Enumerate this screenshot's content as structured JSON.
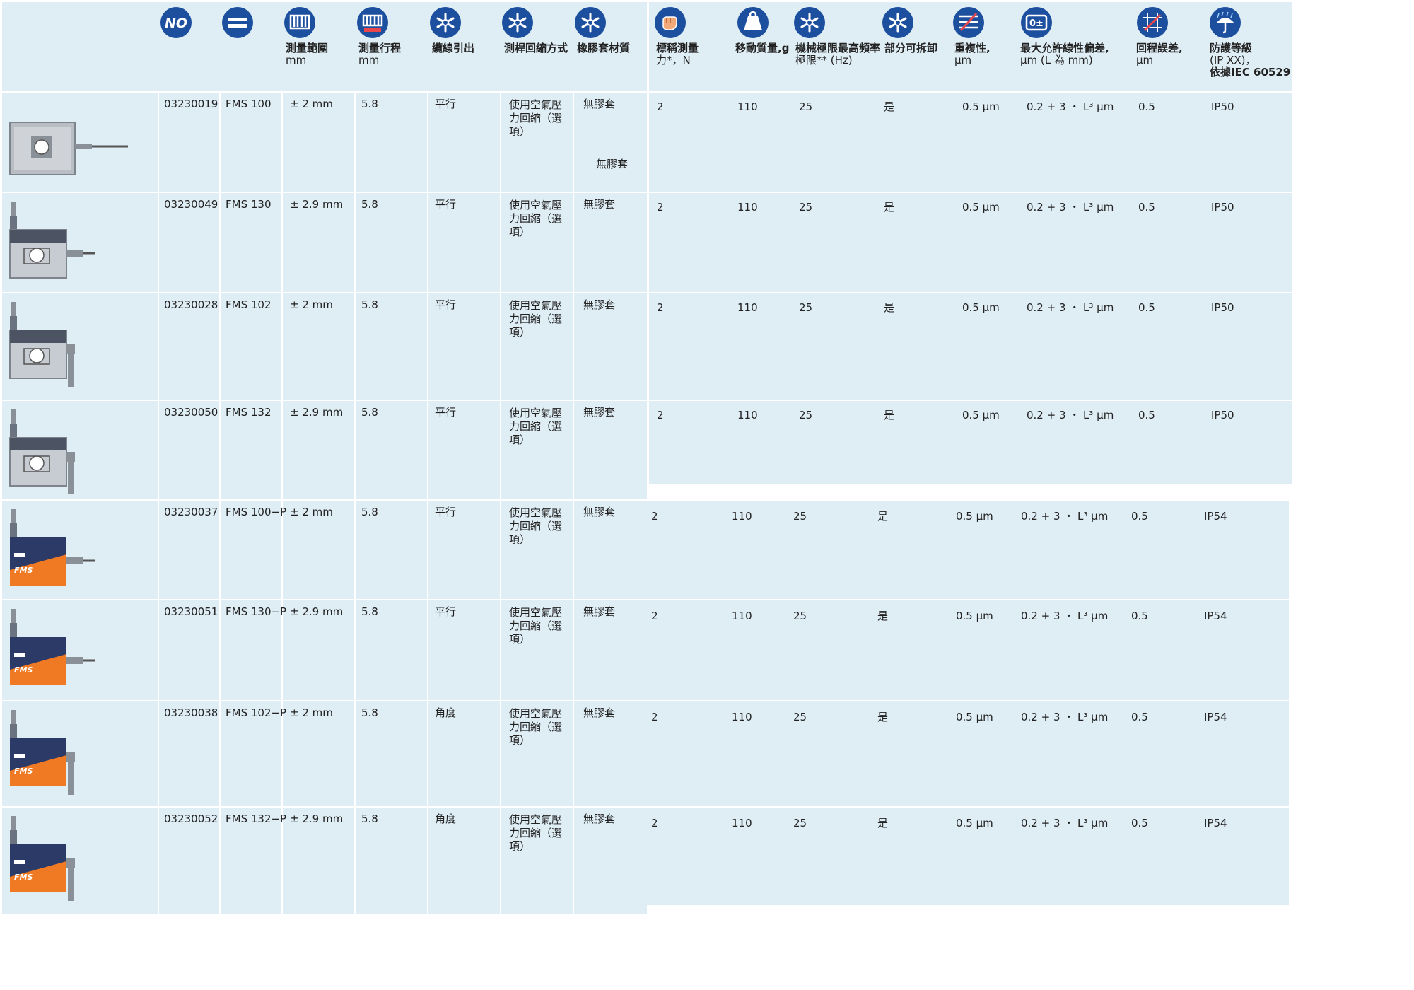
{
  "header": {
    "icons": {
      "col_no": "no-icon",
      "col_model": "double-bar-icon",
      "col_range": "measuring-range-icon",
      "col_stroke": "measuring-stroke-icon",
      "col_cable": "cable-exit-icon",
      "col_retract": "retraction-icon",
      "col_gaiter": "gaiter-material-icon",
      "col_force": "hand-force-icon",
      "col_mass": "moving-mass-icon",
      "col_freq": "frequency-icon",
      "col_detach": "detachable-icon",
      "col_repeat": "repeatability-icon",
      "col_linearity": "linearity-icon",
      "col_hysteresis": "hysteresis-icon",
      "col_ip": "protection-umbrella-icon"
    },
    "no_icon_text": "NO",
    "linearity_icon_text": "0±",
    "range_l1": "測量範圍",
    "range_l2": "mm",
    "stroke_l1": "測量行程",
    "stroke_l2": "mm",
    "cable": "纜線引出",
    "retract": "測桿回縮方式",
    "gaiter": "橡膠套材質",
    "force_l1": "標稱測量",
    "force_l2": "力*，N",
    "mass": "移動質量,g",
    "freq_l1": "機械極限最高頻率",
    "freq_l2": "極限** (Hz)",
    "detach": "部分可拆卸",
    "repeat_l1": "重複性,",
    "repeat_l2": "μm",
    "linearity_l1": "最大允許線性偏差,",
    "linearity_l2": "μm (L 為 mm)",
    "hysteresis_l1": "回程誤差,",
    "hysteresis_l2": "μm",
    "ip_l1": "防護等級",
    "ip_l2": "(IP XX)，",
    "ip_l3": "依據IEC 60529"
  },
  "rows": [
    {
      "no": "03230019",
      "model": "FMS 100",
      "range": "± 2 mm",
      "stroke": "5.8",
      "cable": "平行",
      "retract": "使用空氣壓力回縮（選項）",
      "gaiter": "無膠套",
      "gaiter2": "無膠套",
      "force": "2",
      "mass": "110",
      "freq": "25",
      "detach": "是",
      "repeat": "0.5 μm",
      "linearity": "0.2 + 3 ・ L³ μm",
      "hysteresis": "0.5",
      "ip": "IP50"
    },
    {
      "no": "03230049",
      "model": "FMS 130",
      "range": "± 2.9 mm",
      "stroke": "5.8",
      "cable": "平行",
      "retract": "使用空氣壓力回縮（選項）",
      "gaiter": "無膠套",
      "force": "2",
      "mass": "110",
      "freq": "25",
      "detach": "是",
      "repeat": "0.5 μm",
      "linearity": "0.2 + 3 ・ L³ μm",
      "hysteresis": "0.5",
      "ip": "IP50"
    },
    {
      "no": "03230028",
      "model": "FMS 102",
      "range": "± 2 mm",
      "stroke": "5.8",
      "cable": "平行",
      "retract": "使用空氣壓力回縮（選項）",
      "gaiter": "無膠套",
      "force": "2",
      "mass": "110",
      "freq": "25",
      "detach": "是",
      "repeat": "0.5 μm",
      "linearity": "0.2 + 3 ・ L³ μm",
      "hysteresis": "0.5",
      "ip": "IP50"
    },
    {
      "no": "03230050",
      "model": "FMS 132",
      "range": "± 2.9 mm",
      "stroke": "5.8",
      "cable": "平行",
      "retract": "使用空氣壓力回縮（選項）",
      "gaiter": "無膠套",
      "force": "2",
      "mass": "110",
      "freq": "25",
      "detach": "是",
      "repeat": "0.5 μm",
      "linearity": "0.2 + 3 ・ L³ μm",
      "hysteresis": "0.5",
      "ip": "IP50"
    },
    {
      "no": "03230037",
      "model": "FMS 100−P",
      "range": "± 2 mm",
      "stroke": "5.8",
      "cable": "平行",
      "retract": "使用空氣壓力回縮（選項）",
      "gaiter": "無膠套",
      "force": "2",
      "mass": "110",
      "freq": "25",
      "detach": "是",
      "repeat": "0.5 μm",
      "linearity": "0.2 + 3 ・ L³ μm",
      "hysteresis": "0.5",
      "ip": "IP54"
    },
    {
      "no": "03230051",
      "model": "FMS 130−P",
      "range": "± 2.9 mm",
      "stroke": "5.8",
      "cable": "平行",
      "retract": "使用空氣壓力回縮（選項）",
      "gaiter": "無膠套",
      "force": "2",
      "mass": "110",
      "freq": "25",
      "detach": "是",
      "repeat": "0.5 μm",
      "linearity": "0.2 + 3 ・ L³ μm",
      "hysteresis": "0.5",
      "ip": "IP54"
    },
    {
      "no": "03230038",
      "model": "FMS 102−P",
      "range": "± 2 mm",
      "stroke": "5.8",
      "cable": "角度",
      "retract": "使用空氣壓力回縮（選項）",
      "gaiter": "無膠套",
      "force": "2",
      "mass": "110",
      "freq": "25",
      "detach": "是",
      "repeat": "0.5 μm",
      "linearity": "0.2 + 3 ・ L³ μm",
      "hysteresis": "0.5",
      "ip": "IP54"
    },
    {
      "no": "03230052",
      "model": "FMS 132−P",
      "range": "± 2.9 mm",
      "stroke": "5.8",
      "cable": "角度",
      "retract": "使用空氣壓力回縮（選項）",
      "gaiter": "無膠套",
      "force": "2",
      "mass": "110",
      "freq": "25",
      "detach": "是",
      "repeat": "0.5 μm",
      "linearity": "0.2 + 3 ・ L³ μm",
      "hysteresis": "0.5",
      "ip": "IP54"
    }
  ],
  "colors": {
    "panel": "#dfedf5",
    "icon_blue": "#1d4f9f",
    "device_orange": "#f07a23",
    "device_navy": "#2b3a67"
  }
}
